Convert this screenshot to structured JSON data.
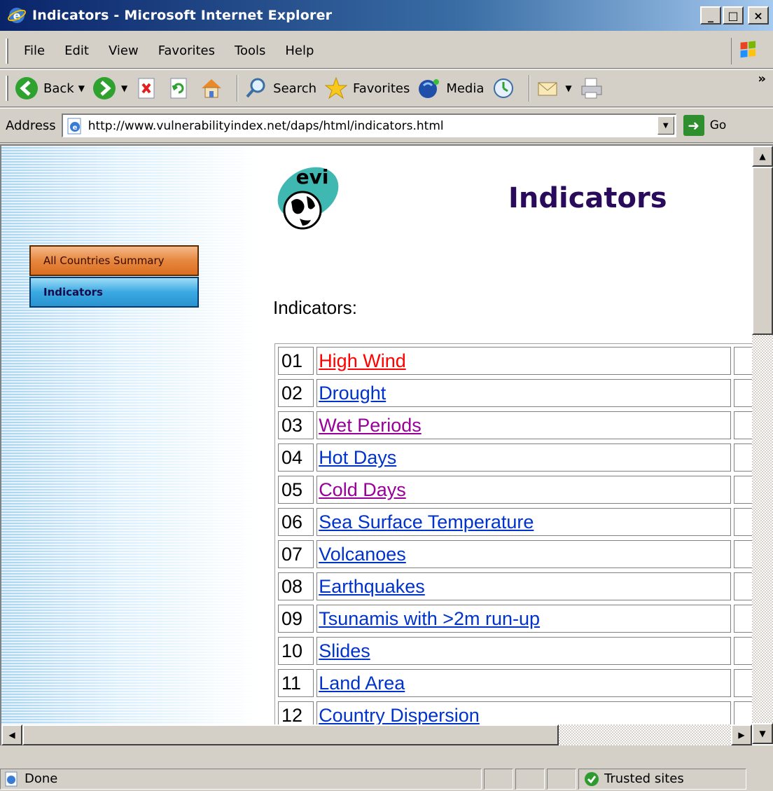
{
  "window": {
    "title": "Indicators - Microsoft Internet Explorer",
    "minimize": "_",
    "maximize": "□",
    "close": "×"
  },
  "menu": [
    "File",
    "Edit",
    "View",
    "Favorites",
    "Tools",
    "Help"
  ],
  "toolbar": {
    "back": "Back",
    "search": "Search",
    "favorites": "Favorites",
    "media": "Media",
    "more": "»"
  },
  "address": {
    "label": "Address",
    "url": "http://www.vulnerabilityindex.net/daps/html/indicators.html",
    "go": "Go"
  },
  "sidebar": {
    "items": [
      {
        "label": "All Countries Summary"
      },
      {
        "label": "Indicators"
      }
    ]
  },
  "page": {
    "logo_text": "evi",
    "title": "Indicators",
    "section_label": "Indicators:"
  },
  "indicators": [
    {
      "num": "01",
      "name": "High Wind",
      "color": "#ff0000"
    },
    {
      "num": "02",
      "name": "Drought",
      "color": "#0033cc"
    },
    {
      "num": "03",
      "name": "Wet Periods",
      "color": "#990099"
    },
    {
      "num": "04",
      "name": "Hot Days",
      "color": "#0033cc"
    },
    {
      "num": "05",
      "name": "Cold Days",
      "color": "#990099"
    },
    {
      "num": "06",
      "name": "Sea Surface Temperature",
      "color": "#0033cc"
    },
    {
      "num": "07",
      "name": "Volcanoes",
      "color": "#0033cc"
    },
    {
      "num": "08",
      "name": "Earthquakes",
      "color": "#0033cc"
    },
    {
      "num": "09",
      "name": "Tsunamis with >2m run-up",
      "color": "#0033cc"
    },
    {
      "num": "10",
      "name": "Slides",
      "color": "#0033cc"
    },
    {
      "num": "11",
      "name": "Land Area",
      "color": "#0033cc"
    },
    {
      "num": "12",
      "name": "Country Dispersion",
      "color": "#0033cc"
    }
  ],
  "status": {
    "text": "Done",
    "zone": "Trusted sites"
  },
  "colors": {
    "title_text": "#2a0a5a",
    "link": "#0033cc",
    "visited": "#990099",
    "active": "#ff0000"
  }
}
